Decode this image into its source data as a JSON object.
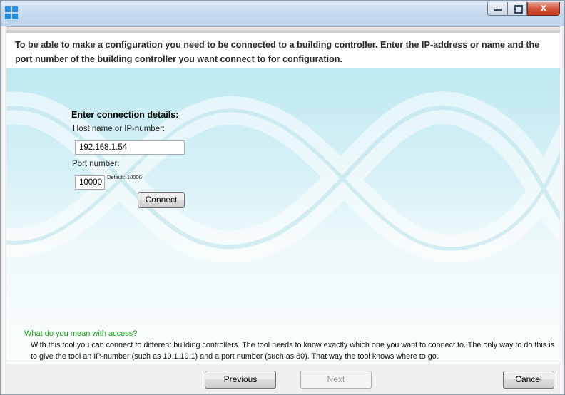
{
  "window": {
    "controls": {
      "minimize_icon": "minimize-icon",
      "maximize_icon": "maximize-icon",
      "close_glyph": "x"
    }
  },
  "header": {
    "text": "To be able to make a configuration you need to be connected to a building controller. Enter the IP-address or name and the port number of the building controller you want connect to for configuration."
  },
  "connection": {
    "title": "Enter connection details:",
    "host_label": "Host name or IP-number:",
    "host_value": "192.168.1.54",
    "port_label": "Port number:",
    "port_value": "10000",
    "port_hint": "Default: 10000",
    "connect_label": "Connect"
  },
  "help": {
    "title": "What do you mean with access?",
    "body": "With this tool you can connect to different building controllers. The tool needs to know exactly which one you want to connect to. The only way to do this is to give the tool an IP-number (such as 10.1.10.1) and a port number (such as 80). That way the tool knows where to go."
  },
  "footer": {
    "previous_label": "Previous",
    "next_label": "Next",
    "cancel_label": "Cancel"
  },
  "colors": {
    "accent": "#1e90e6",
    "help_title": "#13a10e",
    "content_bg": "#bfe9f2"
  }
}
